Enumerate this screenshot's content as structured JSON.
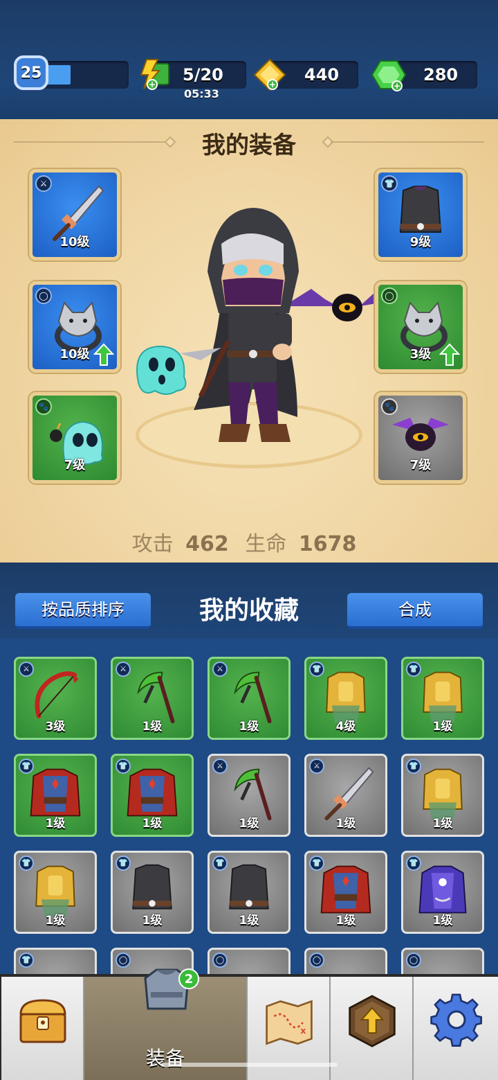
{
  "header": {
    "player_level": "25",
    "xp_fraction": 0.3,
    "energy": "5/20",
    "energy_timer": "05:33",
    "gold": "440",
    "gems": "280"
  },
  "equipment": {
    "title": "我的装备",
    "left_slots": [
      {
        "type": "weapon",
        "item": "sword",
        "level": "10级",
        "color": "blue"
      },
      {
        "type": "ring",
        "item": "wolf-ring",
        "level": "10级",
        "color": "blue",
        "upgradable": true
      },
      {
        "type": "pet",
        "item": "ghost-pet",
        "level": "7级",
        "color": "green"
      }
    ],
    "right_slots": [
      {
        "type": "armor",
        "item": "dark-vest",
        "level": "9级",
        "color": "blue"
      },
      {
        "type": "ring",
        "item": "wolf-ring",
        "level": "3级",
        "color": "green",
        "upgradable": true
      },
      {
        "type": "pet",
        "item": "bat-pet",
        "level": "7级",
        "color": "gray"
      }
    ],
    "attack_label": "攻击",
    "attack_value": "462",
    "hp_label": "生命",
    "hp_value": "1678"
  },
  "collection": {
    "sort_button": "按品质排序",
    "title": "我的收藏",
    "merge_button": "合成",
    "items": [
      {
        "type": "weapon",
        "item": "bow",
        "level": "3级",
        "color": "green"
      },
      {
        "type": "weapon",
        "item": "scythe",
        "level": "1级",
        "color": "green"
      },
      {
        "type": "weapon",
        "item": "scythe",
        "level": "1级",
        "color": "green"
      },
      {
        "type": "armor",
        "item": "gold-armor",
        "level": "4级",
        "color": "green"
      },
      {
        "type": "armor",
        "item": "gold-armor",
        "level": "1级",
        "color": "green"
      },
      {
        "type": "armor",
        "item": "red-robe",
        "level": "1级",
        "color": "green"
      },
      {
        "type": "armor",
        "item": "red-robe",
        "level": "1级",
        "color": "green"
      },
      {
        "type": "weapon",
        "item": "scythe",
        "level": "1级",
        "color": "gray"
      },
      {
        "type": "weapon",
        "item": "sword",
        "level": "1级",
        "color": "gray"
      },
      {
        "type": "armor",
        "item": "gold-armor",
        "level": "1级",
        "color": "gray"
      },
      {
        "type": "armor",
        "item": "gold-armor",
        "level": "1级",
        "color": "gray"
      },
      {
        "type": "armor",
        "item": "dark-vest",
        "level": "1级",
        "color": "gray"
      },
      {
        "type": "armor",
        "item": "dark-vest",
        "level": "1级",
        "color": "gray"
      },
      {
        "type": "armor",
        "item": "red-robe",
        "level": "1级",
        "color": "gray"
      },
      {
        "type": "armor",
        "item": "purple-robe",
        "level": "1级",
        "color": "gray"
      }
    ]
  },
  "nav": {
    "items": [
      {
        "name": "shop",
        "label": ""
      },
      {
        "name": "equipment",
        "label": "装备",
        "badge": "2"
      },
      {
        "name": "map",
        "label": ""
      },
      {
        "name": "upgrade",
        "label": ""
      },
      {
        "name": "settings",
        "label": ""
      }
    ]
  }
}
